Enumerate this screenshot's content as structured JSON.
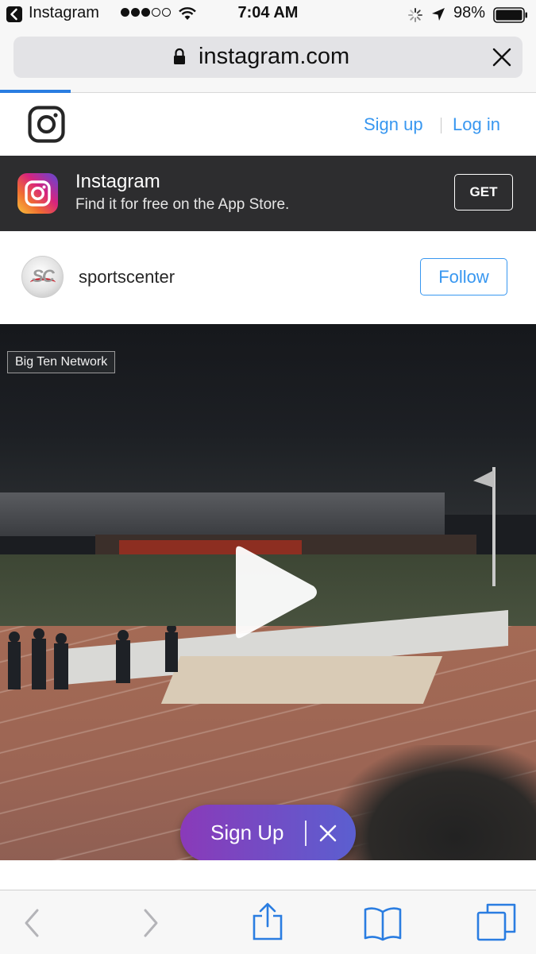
{
  "status_bar": {
    "back_app": "Instagram",
    "time": "7:04 AM",
    "battery": "98%"
  },
  "browser": {
    "url": "instagram.com"
  },
  "ig_header": {
    "signup": "Sign up",
    "login": "Log in"
  },
  "app_banner": {
    "title": "Instagram",
    "subtitle": "Find it for free on the App Store.",
    "get_label": "GET"
  },
  "post": {
    "username": "sportscenter",
    "avatar_text": "SC",
    "follow_label": "Follow",
    "video_network_tag": "Big Ten Network"
  },
  "signup_pill": {
    "label": "Sign Up"
  },
  "colors": {
    "link_blue": "#3897f0",
    "banner_dark": "#2d2d2f",
    "pill_start": "#8a3ab9",
    "pill_end": "#5b5fd0",
    "safari_blue": "#2a7de1"
  },
  "icons": {
    "back_app": "chevron-left-icon",
    "wifi": "wifi-icon",
    "activity": "spinner-icon",
    "location": "location-arrow-icon",
    "battery": "battery-icon",
    "lock": "lock-icon",
    "url_clear": "close-icon",
    "ig_logo": "instagram-logo-icon",
    "play": "play-icon",
    "toolbar": [
      "back-icon",
      "forward-icon",
      "share-icon",
      "bookmarks-icon",
      "tabs-icon"
    ]
  }
}
